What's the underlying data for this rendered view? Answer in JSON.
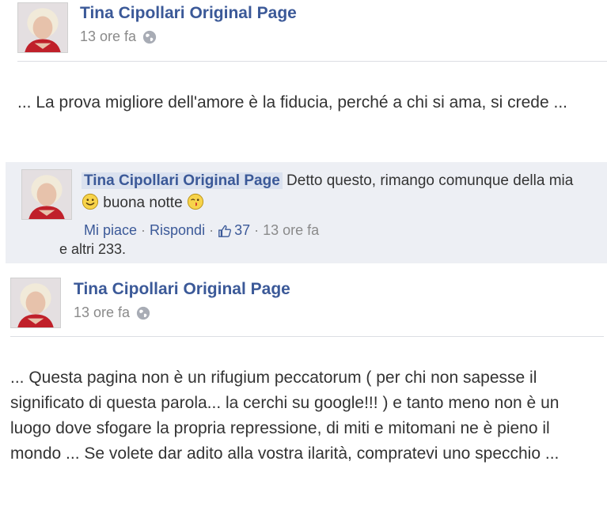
{
  "post1": {
    "author": "Tina Cipollari Original Page",
    "time": "13 ore fa",
    "text": "... La prova migliore dell'amore è la fiducia, perché a chi si ama, si crede ..."
  },
  "comment": {
    "author": "Tina Cipollari Original Page",
    "text_part1": "Detto questo, rimango comunque della mia",
    "text_part2": "buona notte",
    "like_label": "Mi piace",
    "reply_label": "Rispondi",
    "separator": "·",
    "like_count": "37",
    "time": "13 ore fa",
    "others": "e altri 233."
  },
  "post2": {
    "author": "Tina Cipollari Original Page",
    "time": "13 ore fa",
    "text": "... Questa pagina non è un rifugium peccatorum ( per chi non sapesse il significato di questa parola... la cerchi su google!!! ) e tanto meno non è un luogo dove sfogare la propria repressione, di miti e mitomani ne è pieno il mondo ... Se volete dar adito alla vostra ilarità, compratevi uno specchio ..."
  },
  "icons": {
    "privacy": "globe-icon",
    "like": "thumbs-up-icon",
    "emoji1": "smiley-icon",
    "emoji2": "kiss-wink-icon"
  },
  "colors": {
    "link": "#3b5998",
    "meta": "#8a8a8a",
    "comment_bg": "#edeff4"
  }
}
